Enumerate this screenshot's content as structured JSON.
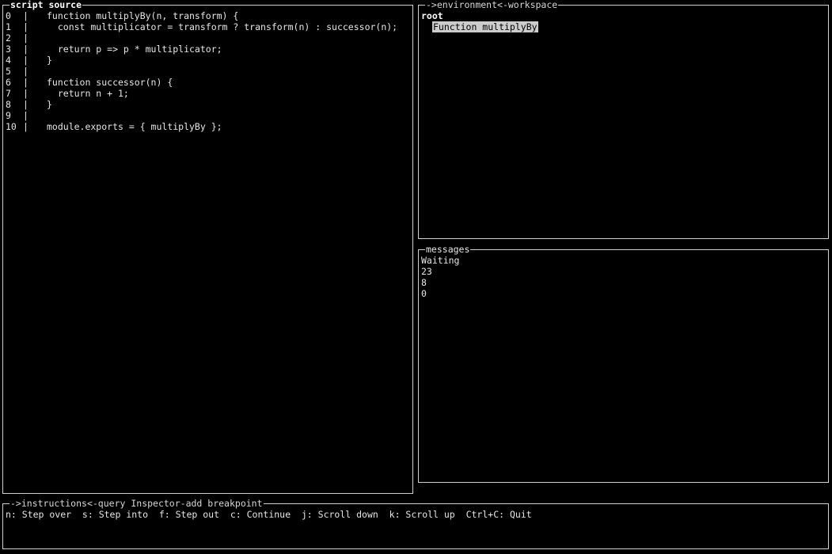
{
  "source_panel": {
    "title": "script source",
    "lines": [
      {
        "num": "0",
        "sep": "|",
        "code": "function multiplyBy(n, transform) {"
      },
      {
        "num": "1",
        "sep": "|",
        "code": "  const multiplicator = transform ? transform(n) : successor(n);"
      },
      {
        "num": "2",
        "sep": "|",
        "code": ""
      },
      {
        "num": "3",
        "sep": "|",
        "code": "  return p => p * multiplicator;"
      },
      {
        "num": "4",
        "sep": "|",
        "code": "}"
      },
      {
        "num": "5",
        "sep": "|",
        "code": ""
      },
      {
        "num": "6",
        "sep": "|",
        "code": "function successor(n) {"
      },
      {
        "num": "7",
        "sep": "|",
        "code": "  return n + 1;"
      },
      {
        "num": "8",
        "sep": "|",
        "code": "}"
      },
      {
        "num": "9",
        "sep": "|",
        "code": ""
      },
      {
        "num": "10",
        "sep": "|",
        "code": "module.exports = { multiplyBy };"
      }
    ]
  },
  "environment_panel": {
    "title_prefix": "->",
    "title_main": "environment",
    "title_suffix": "<-workspace",
    "root_label": "root",
    "selected_item": "Function multiplyBy"
  },
  "messages_panel": {
    "title": "messages",
    "lines": [
      "Waiting",
      "23",
      "8",
      "0"
    ]
  },
  "instructions_panel": {
    "title_prefix": "->",
    "title_main": "instructions",
    "title_suffix": "<-query Inspector-add breakpoint",
    "text": "n: Step over  s: Step into  f: Step out  c: Continue  j: Scroll down  k: Scroll up  Ctrl+C: Quit"
  }
}
